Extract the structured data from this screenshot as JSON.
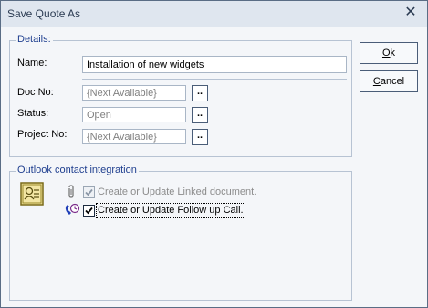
{
  "window": {
    "title": "Save Quote As",
    "close_glyph": "✕"
  },
  "details": {
    "legend": "Details:",
    "name_label": "Name:",
    "name_value": "Installation of new widgets",
    "docno_label": "Doc No:",
    "docno_value": "{Next Available}",
    "status_label": "Status:",
    "status_value": "Open",
    "projectno_label": "Project No:",
    "projectno_value": "{Next Available}",
    "browse_label": ".."
  },
  "outlook": {
    "legend": "Outlook contact integration",
    "linked_doc": {
      "label": "Create or Update Linked document.",
      "checked": true,
      "enabled": false,
      "icon": "paperclip-icon"
    },
    "follow_up": {
      "label": "Create or Update Follow up Call.",
      "checked": true,
      "enabled": true,
      "icon": "phone-clock-icon"
    },
    "contact_icon": "contact-card-icon"
  },
  "buttons": {
    "ok_prefix": "",
    "ok_underline": "O",
    "ok_rest": "k",
    "cancel_underline": "C",
    "cancel_rest": "ancel"
  }
}
